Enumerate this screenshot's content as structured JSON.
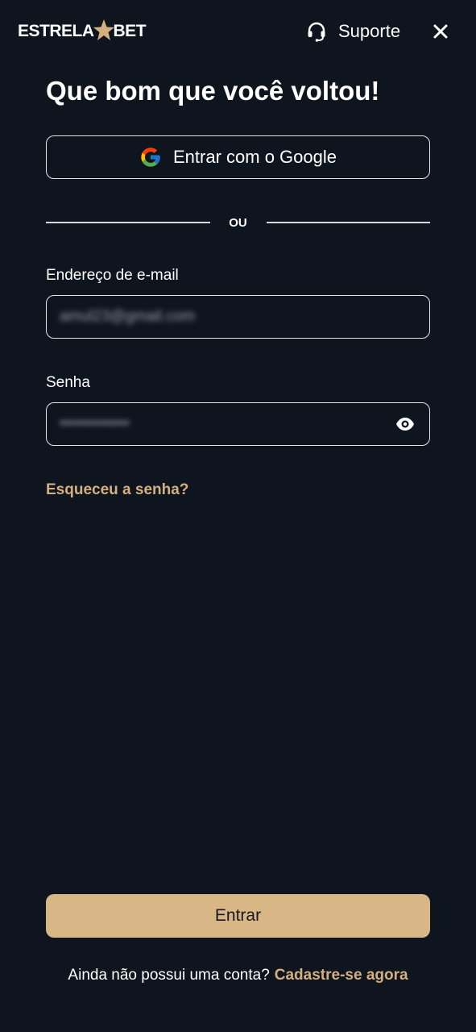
{
  "header": {
    "logo_left": "ESTRELA",
    "logo_right": "BET",
    "support_label": "Suporte"
  },
  "main": {
    "title": "Que bom que você voltou!",
    "google_button_label": "Entrar com o Google",
    "divider_text": "OU",
    "email": {
      "label": "Endereço de e-mail",
      "value": "amul23@gmail.com"
    },
    "password": {
      "label": "Senha",
      "value": "•••••••••••••"
    },
    "forgot_password_label": "Esqueceu a senha?",
    "submit_label": "Entrar",
    "signup_prompt": "Ainda não possui uma conta?",
    "signup_link": "Cadastre-se agora"
  },
  "colors": {
    "background": "#0e151e",
    "accent": "#d5b07f",
    "button": "#d8b685"
  },
  "icons": [
    "star-icon",
    "headset-icon",
    "close-icon",
    "google-icon",
    "eye-icon"
  ]
}
